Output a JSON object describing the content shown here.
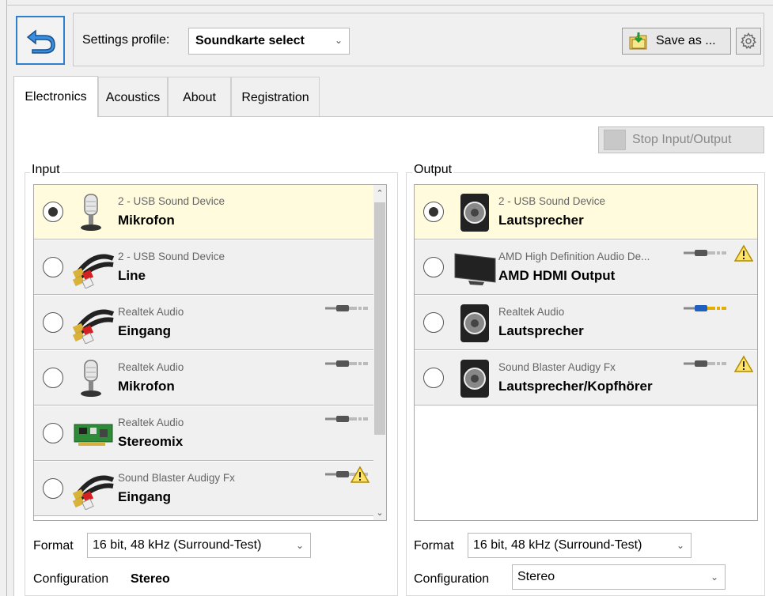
{
  "toolbar": {
    "profile_label": "Settings profile:",
    "profile_value": "Soundkarte select",
    "save_label": "Save as ..."
  },
  "tabs": [
    {
      "label": "Electronics",
      "active": true
    },
    {
      "label": "Acoustics",
      "active": false
    },
    {
      "label": "About",
      "active": false
    },
    {
      "label": "Registration",
      "active": false
    }
  ],
  "stop_button": "Stop Input/Output",
  "input": {
    "title": "Input",
    "devices": [
      {
        "device": "2 - USB Sound Device",
        "port": "Mikrofon",
        "icon": "microphone-icon",
        "selected": true,
        "jack": "",
        "warning": false
      },
      {
        "device": "2 - USB Sound Device",
        "port": "Line",
        "icon": "rca-cable-icon",
        "selected": false,
        "jack": "",
        "warning": false
      },
      {
        "device": "Realtek Audio",
        "port": "Eingang",
        "icon": "rca-cable-icon",
        "selected": false,
        "jack": "gray",
        "warning": false
      },
      {
        "device": "Realtek Audio",
        "port": "Mikrofon",
        "icon": "microphone-icon",
        "selected": false,
        "jack": "gray",
        "warning": false
      },
      {
        "device": "Realtek Audio",
        "port": "Stereomix",
        "icon": "sound-card-icon",
        "selected": false,
        "jack": "gray",
        "warning": false
      },
      {
        "device": "Sound Blaster Audigy Fx",
        "port": "Eingang",
        "icon": "rca-cable-icon",
        "selected": false,
        "jack": "gray",
        "warning": true
      }
    ],
    "format_label": "Format",
    "format_value": "16 bit, 48 kHz (Surround-Test)",
    "config_label": "Configuration",
    "config_value": "Stereo"
  },
  "output": {
    "title": "Output",
    "devices": [
      {
        "device": "2 - USB Sound Device",
        "port": "Lautsprecher",
        "icon": "speaker-icon",
        "selected": true,
        "jack": "",
        "warning": false
      },
      {
        "device": "AMD High Definition Audio De...",
        "port": "AMD HDMI Output",
        "icon": "monitor-icon",
        "selected": false,
        "jack": "gray",
        "warning": true
      },
      {
        "device": "Realtek Audio",
        "port": "Lautsprecher",
        "icon": "speaker-icon",
        "selected": false,
        "jack": "blue",
        "warning": false
      },
      {
        "device": "Sound Blaster Audigy Fx",
        "port": "Lautsprecher/Kopfhörer",
        "icon": "speaker-icon",
        "selected": false,
        "jack": "gray",
        "warning": true
      }
    ],
    "format_label": "Format",
    "format_value": "16 bit, 48 kHz (Surround-Test)",
    "config_label": "Configuration",
    "config_value": "Stereo"
  },
  "colors": {
    "selected_row": "#fffbdc",
    "row": "#f0f0f0",
    "accent": "#2f7fd0",
    "warning": "#f2c200",
    "jack_blue": "#1f5fc0"
  }
}
